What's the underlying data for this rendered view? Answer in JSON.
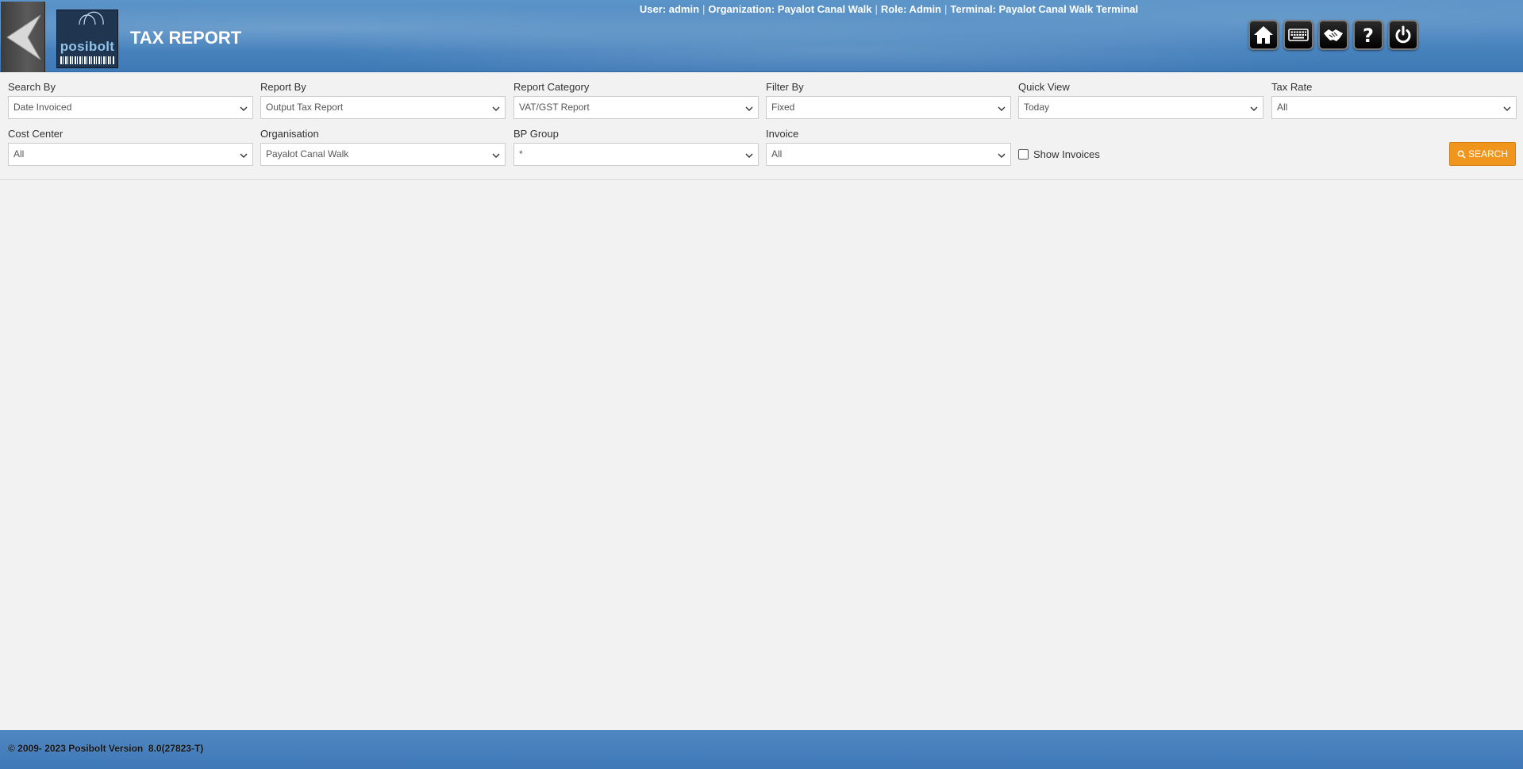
{
  "header": {
    "title": "TAX REPORT",
    "logo_text": "posibolt",
    "user_label": "User: admin",
    "org_label": "Organization: Payalot Canal Walk",
    "role_label": "Role: Admin",
    "terminal_label": "Terminal: Payalot Canal Walk Terminal",
    "separator": "|"
  },
  "toolbar": {
    "icons": [
      "home-icon",
      "keyboard-icon",
      "handshake-icon",
      "help-icon",
      "power-icon"
    ]
  },
  "form": {
    "search_by": {
      "label": "Search By",
      "value": "Date Invoiced"
    },
    "report_by": {
      "label": "Report By",
      "value": "Output Tax Report"
    },
    "report_category": {
      "label": "Report Category",
      "value": "VAT/GST Report"
    },
    "filter_by": {
      "label": "Filter By",
      "value": "Fixed"
    },
    "quick_view": {
      "label": "Quick View",
      "value": "Today"
    },
    "tax_rate": {
      "label": "Tax Rate",
      "value": "All"
    },
    "cost_center": {
      "label": "Cost Center",
      "value": "All"
    },
    "organisation": {
      "label": "Organisation",
      "value": "Payalot Canal Walk"
    },
    "bp_group": {
      "label": "BP Group",
      "value": "*"
    },
    "invoice": {
      "label": "Invoice",
      "value": "All"
    },
    "show_invoices": {
      "label": "Show Invoices",
      "checked": false
    },
    "search_button": "SEARCH"
  },
  "footer": {
    "text": "© 2009- 2023 Posibolt Version  8.0(27823-T)"
  },
  "colors": {
    "header_blue": "#4a86c0",
    "search_orange": "#f0961f",
    "background": "#f2f2f2"
  }
}
